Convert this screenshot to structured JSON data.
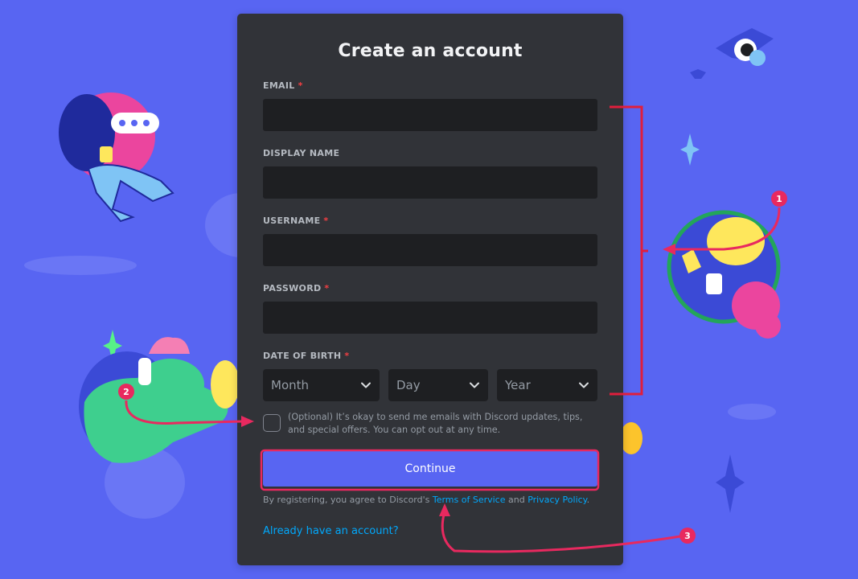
{
  "colors": {
    "background": "#5865f2",
    "card": "#313338",
    "input": "#1e1f22",
    "accent": "#5865f2",
    "link": "#00a8fc",
    "required": "#f23f43",
    "annotation": "#e8295f"
  },
  "form": {
    "title": "Create an account",
    "email_label": "EMAIL",
    "display_name_label": "DISPLAY NAME",
    "username_label": "USERNAME",
    "password_label": "PASSWORD",
    "dob_label": "DATE OF BIRTH",
    "required_mark": "*",
    "email_value": "",
    "display_name_value": "",
    "username_value": "",
    "password_value": "",
    "dob": {
      "month_placeholder": "Month",
      "day_placeholder": "Day",
      "year_placeholder": "Year"
    },
    "optin_text": "(Optional) It’s okay to send me emails with Discord updates, tips, and special offers. You can opt out at any time.",
    "optin_checked": false,
    "continue_label": "Continue",
    "terms": {
      "prefix": "By registering, you agree to Discord's ",
      "tos": "Terms of Service",
      "middle": " and ",
      "privacy": "Privacy Policy",
      "suffix": "."
    },
    "have_account": "Already have an account?"
  },
  "annotations": {
    "markers": [
      "1",
      "2",
      "3"
    ]
  }
}
